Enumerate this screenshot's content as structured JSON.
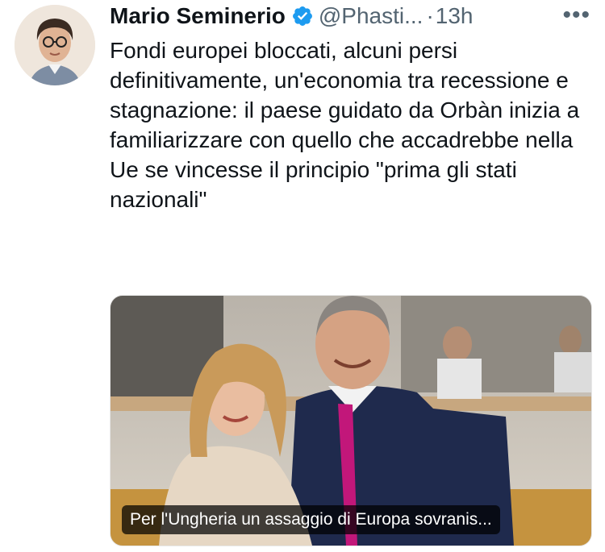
{
  "tweet": {
    "author_name": "Mario Seminerio",
    "handle": "@Phasti...",
    "separator": "·",
    "time": "13h",
    "more_label": "•••",
    "text": "Fondi europei bloccati, alcuni persi definitivamente, un'economia tra recessione e stagnazione: il paese guidato da Orbàn inizia a familiarizzare con quello che accadrebbe nella Ue se vincesse il principio \"prima gli stati nazionali\"",
    "verified": true,
    "verified_color": "#1d9bf0"
  },
  "media": {
    "caption": "Per l'Ungheria un assaggio di Europa sovranis..."
  },
  "icons": {
    "verified": "verified-badge-icon",
    "more": "more-options-icon"
  }
}
